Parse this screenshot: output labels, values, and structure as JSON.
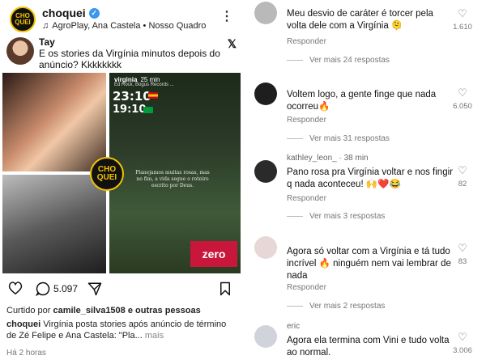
{
  "post": {
    "username": "choquei",
    "audio": "AgroPlay, Ana Castela • Nosso Quadro",
    "logo_text": "CHO QUEI",
    "tweet": {
      "name": "Tay",
      "text": "E os stories da Virgínia minutos depois do anúncio? Kkkkkkkk"
    },
    "story": {
      "user": "virginia",
      "time_ago": "25 min",
      "song": "Ed Rock, Bogus Records ...",
      "time1": "23:10",
      "time2": "19:10",
      "caption": "Planejamos muitas rosas, mas no fim, a vida segue o roteiro escrito por Deus.",
      "badge": "zero"
    },
    "comments_count": "5.097",
    "liked_by_prefix": "Curtido por",
    "liked_by_user": "camile_silva1508",
    "liked_by_suffix": "e outras pessoas",
    "caption_user": "choquei",
    "caption_text": "Virgínia posta stories após anúncio de término de Zé Felipe e Ana Castela: \"Pla...",
    "caption_more": "mais",
    "time": "Há 2 horas"
  },
  "comments": [
    {
      "user": "",
      "text": "Meu desvio de caráter é torcer pela volta dele com a Virgínia 🫠",
      "likes": "1.610",
      "reply": "Responder",
      "more": "Ver mais 24 respostas"
    },
    {
      "user": "",
      "text": "Voltem logo,  a gente finge que nada ocorreu🔥",
      "likes": "6.050",
      "reply": "Responder",
      "more": "Ver mais 31 respostas"
    },
    {
      "user": "kathley_leon_ · 38 min",
      "text": "Pano rosa pra Virgínia voltar e nos fingir q nada aconteceu! 🙌❤️😂",
      "likes": "82",
      "reply": "Responder",
      "more": "Ver mais 3 respostas"
    },
    {
      "user": "",
      "text": "Agora só voltar com a Virgínia e tá tudo incrível 🔥 ninguém nem vai lembrar de nada",
      "likes": "83",
      "reply": "Responder",
      "more": "Ver mais 2 respostas"
    },
    {
      "user": "eric",
      "text": "Agora ela termina com Vini e tudo volta ao normal.",
      "likes": "3.006",
      "reply": "",
      "more": ""
    }
  ]
}
